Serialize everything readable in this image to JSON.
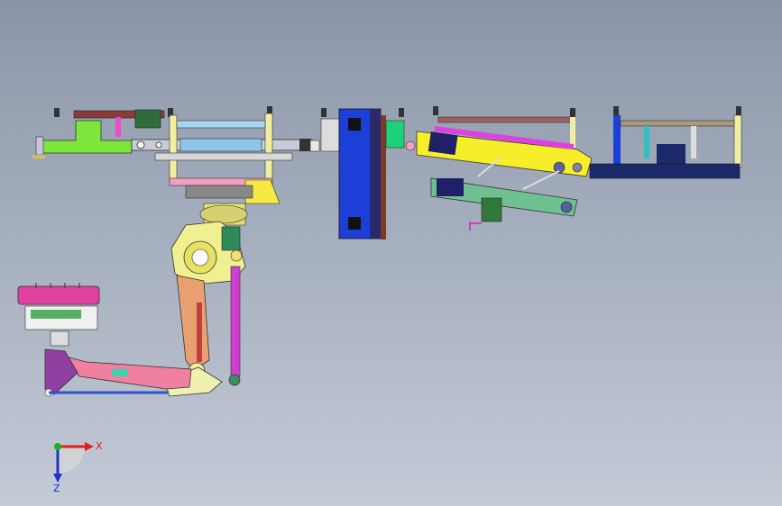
{
  "viewport": {
    "background_top": "#8a96a8",
    "background_bottom": "#c4cad6"
  },
  "triad": {
    "x_label": "X",
    "z_label": "Z",
    "x_color": "#e02020",
    "y_color": "#20b020",
    "z_color": "#2030d0"
  },
  "model": {
    "description_icon": "cad-assembly-icon"
  }
}
